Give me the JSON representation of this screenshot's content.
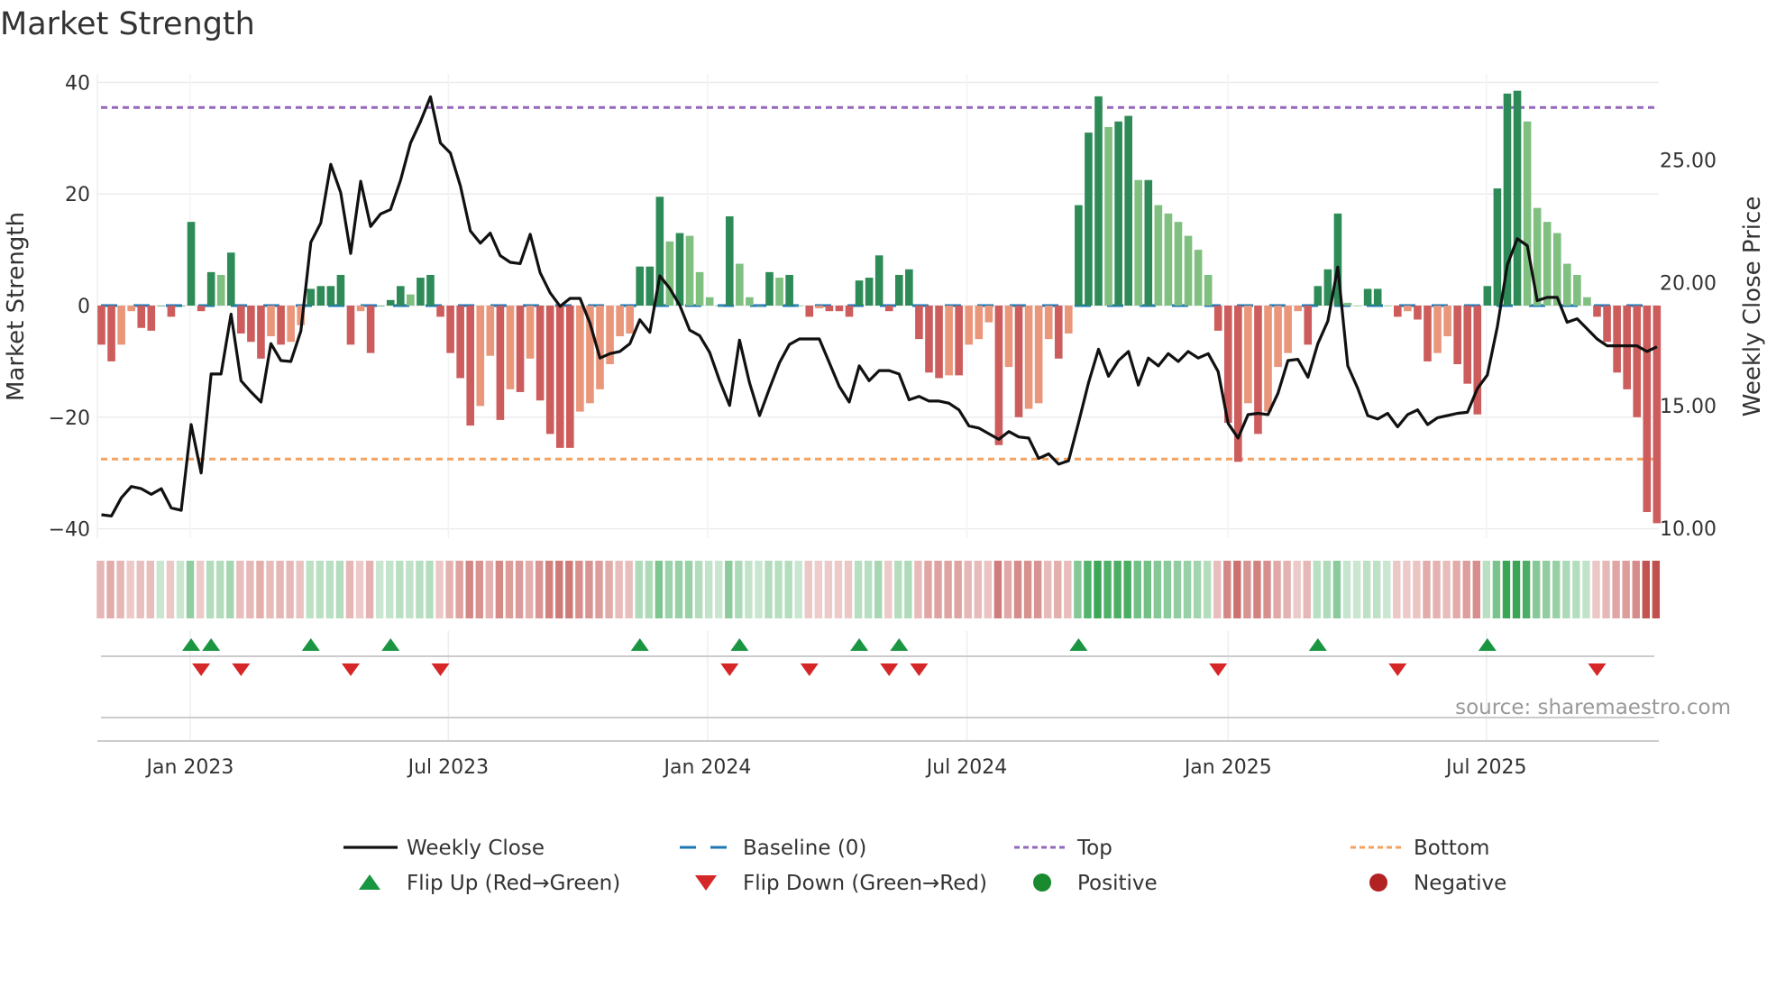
{
  "title": "Market Strength",
  "source": "source: sharemaestro.com",
  "colors": {
    "pos_strong": "#2e8b57",
    "pos_weak": "#7fbf7f",
    "neg_strong": "#cd5c5c",
    "neg_weak": "#e9967a",
    "line": "#111111",
    "baseline": "#1f77b4",
    "top": "#9467bd",
    "bottom": "#f4a261",
    "flip_up": "#1a9641",
    "flip_down": "#d62728",
    "positive": "#1a8a2e",
    "negative": "#b22222"
  },
  "legend": [
    {
      "label": "Weekly Close",
      "icon": "line-icon"
    },
    {
      "label": "Baseline (0)",
      "icon": "dashed-line-icon"
    },
    {
      "label": "Top",
      "icon": "dotted-line-icon"
    },
    {
      "label": "Bottom",
      "icon": "dotted-line-icon"
    },
    {
      "label": "Flip Up (Red→Green)",
      "icon": "triangle-up-icon"
    },
    {
      "label": "Flip Down (Green→Red)",
      "icon": "triangle-down-icon"
    },
    {
      "label": "Positive",
      "icon": "dot-icon"
    },
    {
      "label": "Negative",
      "icon": "dot-icon"
    }
  ],
  "chart_data": {
    "type": "bar",
    "title": "Market Strength",
    "ylabel": "Market Strength",
    "y2label": "Weekly Close Price",
    "ylim": [
      -42,
      42
    ],
    "y2lim": [
      10,
      28
    ],
    "yticks": [
      "40",
      "20",
      "0",
      "−20",
      "−40"
    ],
    "ytick_values": [
      40,
      20,
      0,
      -20,
      -40
    ],
    "y2ticks": [
      "25.00",
      "20.00",
      "15.00",
      "10.00"
    ],
    "y2tick_values": [
      25,
      20,
      15,
      10
    ],
    "xticks": [
      "Jan 2023",
      "Jul 2023",
      "Jan 2024",
      "Jul 2024",
      "Jan 2025",
      "Jul 2025"
    ],
    "xtick_week_index": [
      8.9,
      34.8,
      60.8,
      86.8,
      113.0,
      138.9
    ],
    "top_level": 35.5,
    "bottom_level": -27.5,
    "grid": true,
    "legend_position": "bottom",
    "strength": [
      -7,
      -10,
      -7,
      -1,
      -4,
      -4.5,
      0,
      -2,
      0,
      15,
      -1,
      6,
      5.5,
      9.5,
      -5,
      -6.5,
      -9.5,
      -5.5,
      -7,
      -6.5,
      -3.5,
      3,
      3.5,
      3.5,
      5.5,
      -7,
      -1,
      -8.5,
      0,
      1,
      3.5,
      2,
      5,
      5.5,
      -2,
      -8.5,
      -13,
      -21.5,
      -18,
      -9,
      -20.5,
      -15,
      -15.5,
      -9.5,
      -17,
      -23,
      -25.5,
      -25.5,
      -19,
      -17.5,
      -15,
      -10.5,
      -5.5,
      -5,
      7,
      7,
      19.5,
      11.5,
      13,
      12.5,
      6,
      1.5,
      0,
      16,
      7.5,
      1.5,
      0,
      6,
      5,
      5.5,
      0,
      -2,
      -0.5,
      -1,
      -1,
      -2,
      4.5,
      5,
      9,
      -1,
      5.5,
      6.5,
      -6,
      -12,
      -13,
      -12.5,
      -12.5,
      -7,
      -6,
      -3,
      -25,
      -11,
      -20,
      -18.5,
      -17.5,
      -6,
      -9.5,
      -5,
      18,
      31,
      37.5,
      32,
      33,
      34,
      22.5,
      22.5,
      18,
      16.5,
      15,
      12.5,
      10,
      5.5,
      -4.5,
      -21,
      -28,
      -17.5,
      -23,
      -19,
      -11,
      -8.5,
      -1,
      -7,
      3.5,
      6.5,
      16.5,
      0.5,
      0,
      3,
      3,
      0,
      -2,
      -1,
      -2.5,
      -10,
      -8.5,
      -5.5,
      -10.5,
      -14,
      -19.5,
      3.5,
      21,
      38,
      38.5,
      33,
      17.5,
      15,
      13,
      7.5,
      5.5,
      1.5,
      -2,
      -6.5,
      -12,
      -15,
      -20,
      -37,
      -39
    ],
    "weekly_close": [
      10.55,
      10.5,
      11.24,
      11.7,
      11.61,
      11.38,
      11.61,
      10.83,
      10.73,
      14.22,
      12.25,
      16.28,
      16.28,
      18.72,
      16.01,
      15.55,
      15.14,
      17.52,
      16.83,
      16.79,
      18.03,
      21.65,
      22.43,
      24.82,
      23.67,
      21.19,
      24.13,
      22.29,
      22.8,
      22.98,
      24.17,
      25.69,
      26.56,
      27.57,
      25.69,
      25.28,
      23.94,
      22.11,
      21.61,
      22.02,
      21.1,
      20.83,
      20.78,
      21.97,
      20.41,
      19.59,
      19.04,
      19.36,
      19.36,
      18.35,
      16.93,
      17.11,
      17.2,
      17.52,
      18.49,
      17.98,
      20.28,
      19.77,
      19.08,
      18.07,
      17.84,
      17.16,
      16.01,
      15.0,
      17.66,
      15.92,
      14.59,
      15.69,
      16.74,
      17.48,
      17.71,
      17.71,
      17.71,
      16.74,
      15.78,
      15.14,
      16.61,
      16.01,
      16.42,
      16.42,
      16.28,
      15.23,
      15.37,
      15.18,
      15.18,
      15.09,
      14.82,
      14.17,
      14.08,
      13.85,
      13.62,
      13.94,
      13.72,
      13.67,
      12.84,
      13.03,
      12.61,
      12.75,
      14.31,
      15.92,
      17.29,
      16.19,
      16.83,
      17.2,
      15.83,
      16.93,
      16.61,
      17.11,
      16.79,
      17.2,
      16.93,
      17.11,
      16.38,
      14.27,
      13.67,
      14.63,
      14.68,
      14.63,
      15.5,
      16.83,
      16.88,
      16.15,
      17.52,
      18.44,
      20.64,
      16.61,
      15.69,
      14.59,
      14.45,
      14.68,
      14.13,
      14.63,
      14.82,
      14.22,
      14.5,
      14.59,
      14.68,
      14.72,
      15.69,
      16.24,
      18.21,
      20.73,
      21.79,
      21.51,
      19.27,
      19.4,
      19.4,
      18.39,
      18.53,
      18.12,
      17.71,
      17.43,
      17.43,
      17.43,
      17.43,
      17.2,
      17.39
    ],
    "flip_up_week_index": [
      9,
      11,
      21,
      29,
      54,
      64,
      76,
      80,
      98,
      122,
      139
    ],
    "flip_down_week_index": [
      10,
      14,
      25,
      34,
      63,
      71,
      79,
      82,
      112,
      130,
      150
    ]
  }
}
